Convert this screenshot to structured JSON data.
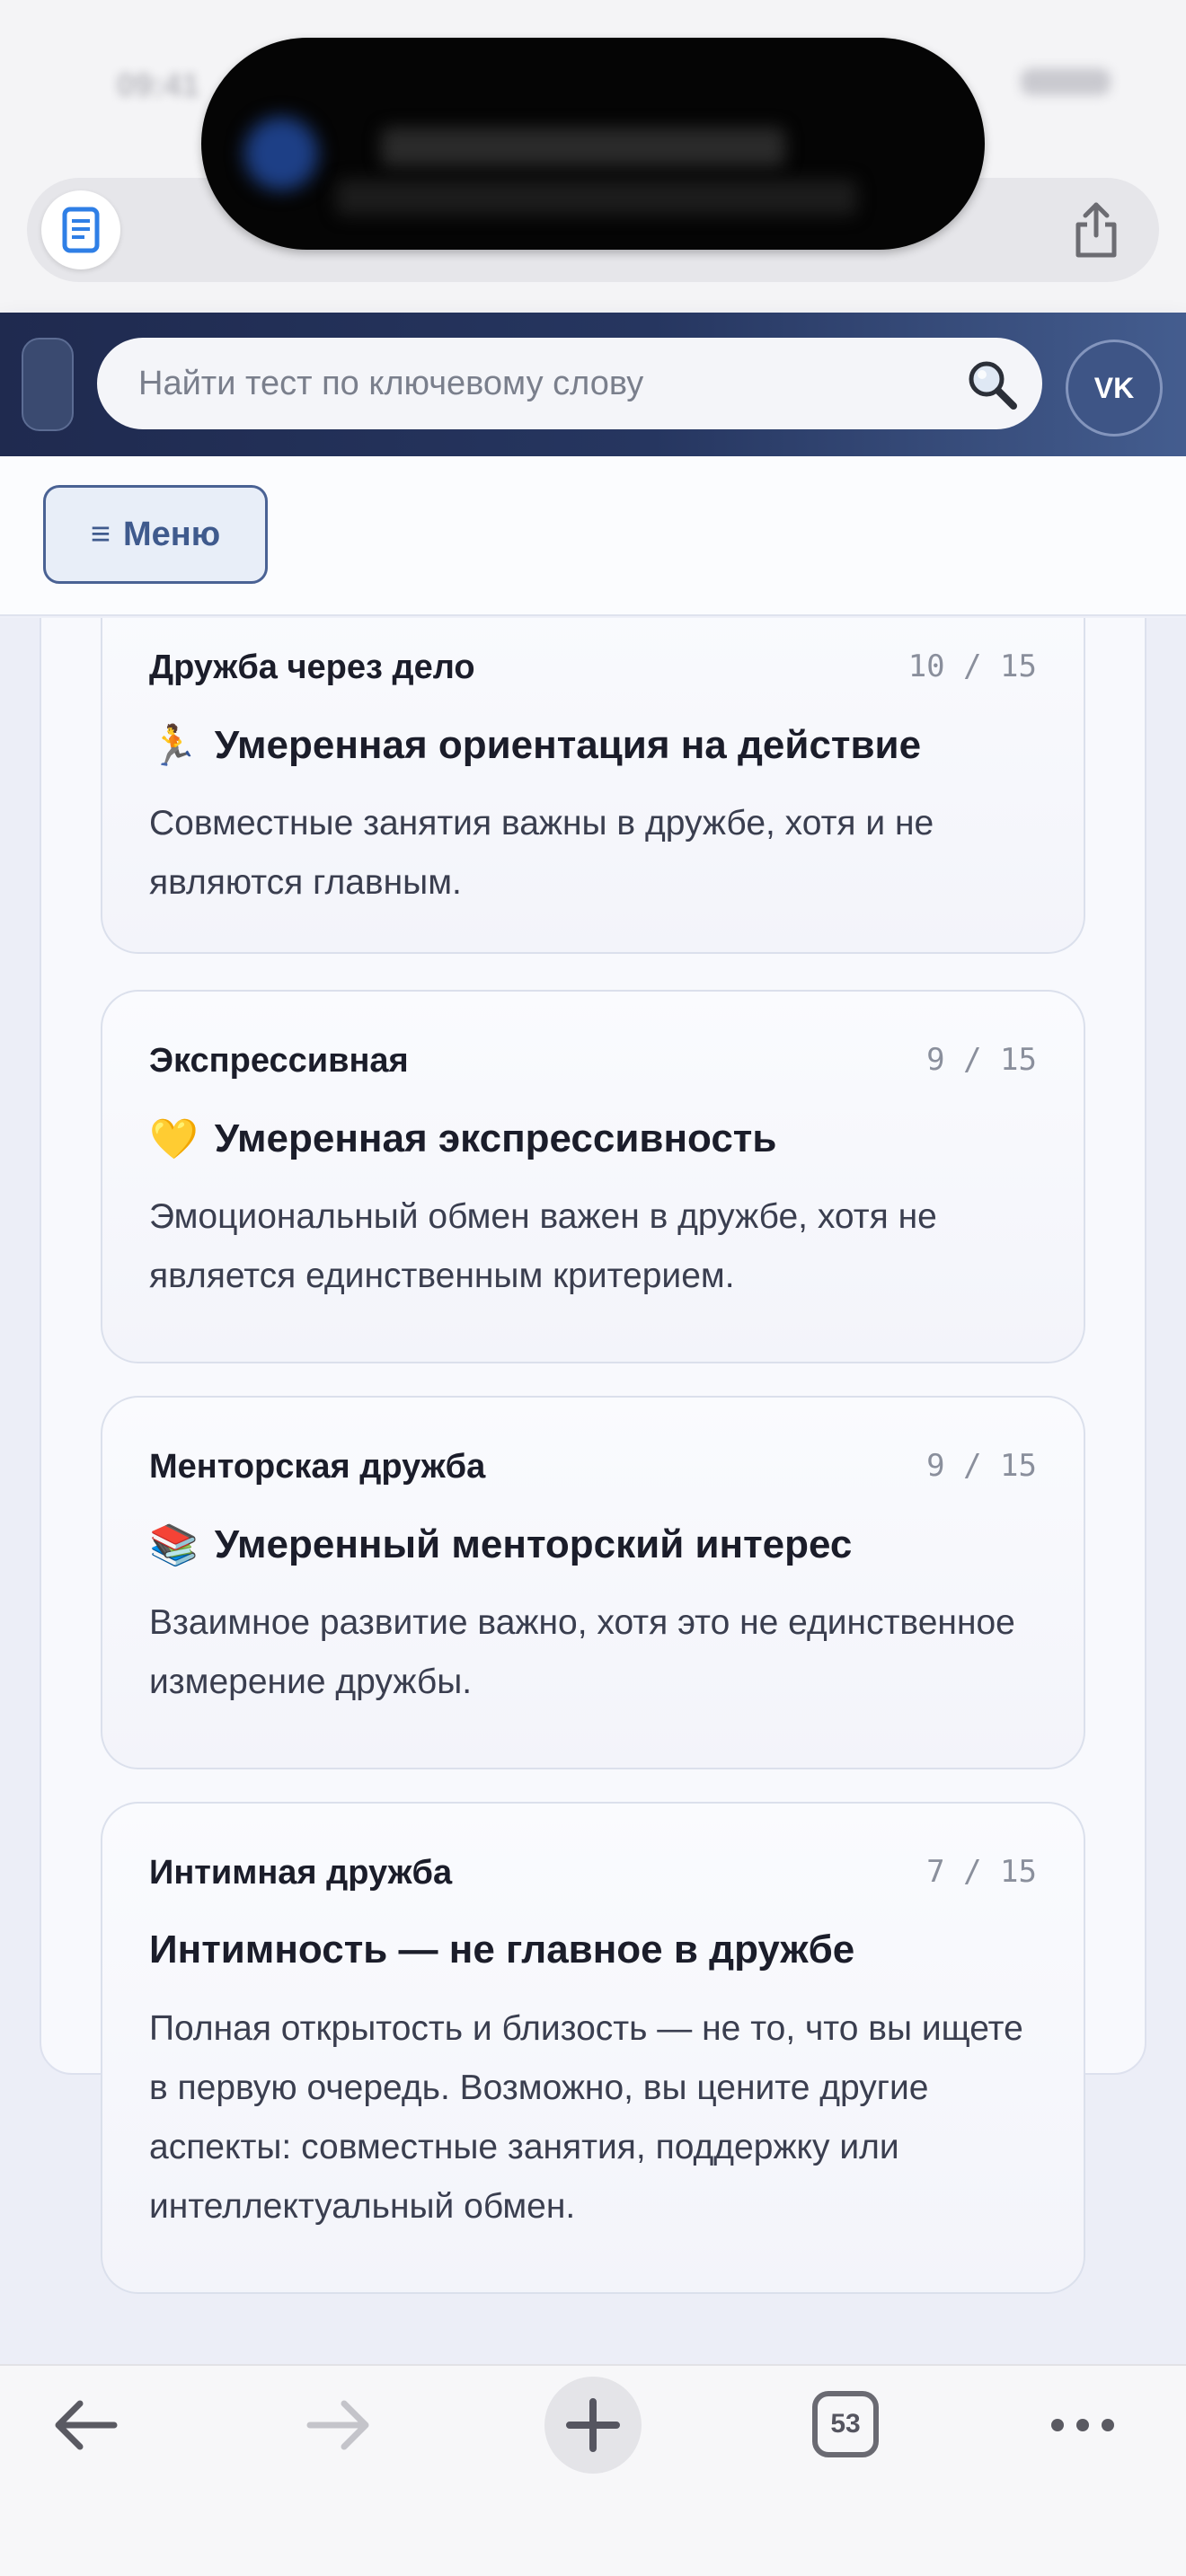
{
  "browser": {
    "tab_count": "53"
  },
  "header": {
    "search_placeholder": "Найти тест по ключевому слову",
    "vk_label": "VK"
  },
  "menu": {
    "icon": "≡",
    "label": "Меню"
  },
  "cards": [
    {
      "category": "Дружба через дело",
      "score": "10 / 15",
      "emoji": "🏃",
      "title": "Умеренная ориентация на действие",
      "description": "Совместные занятия важны в дружбе, хотя и не являются главным."
    },
    {
      "category": "Экспрессивная",
      "score": "9 / 15",
      "emoji": "💛",
      "title": "Умеренная экспрессивность",
      "description": "Эмоциональный обмен важен в дружбе, хотя не является единственным критерием."
    },
    {
      "category": "Менторская дружба",
      "score": "9 / 15",
      "emoji": "📚",
      "title": "Умеренный менторский интерес",
      "description": "Взаимное развитие важно, хотя это не единственное измерение дружбы."
    },
    {
      "category": "Интимная дружба",
      "score": "7 / 15",
      "emoji": "",
      "title": "Интимность — не главное в дружбе",
      "description": "Полная открытость и близость — не то, что вы ищете в первую очередь. Возможно, вы цените другие аспекты: совместные занятия, поддержку или интеллектуальный обмен."
    }
  ],
  "colors": {
    "header_dark": "#1f2a4f",
    "accent": "#3f5a8d"
  }
}
